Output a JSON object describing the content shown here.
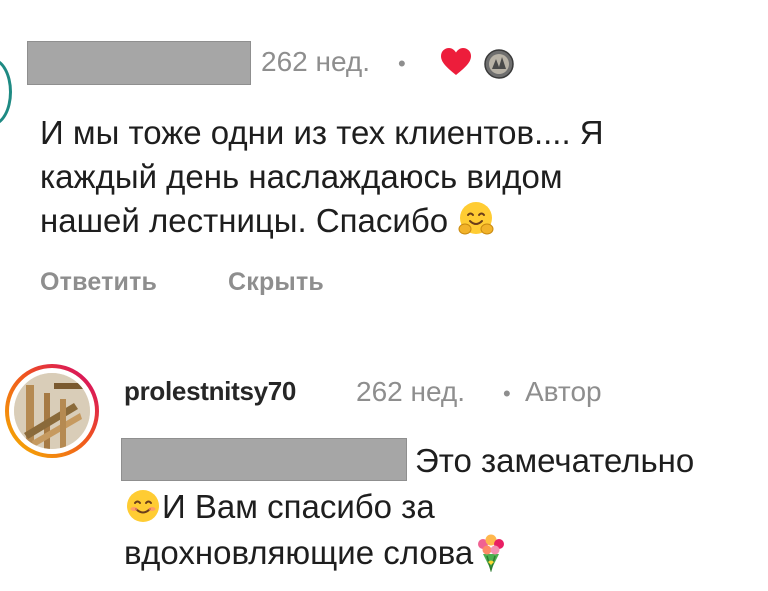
{
  "comment1": {
    "time": "262 нед.",
    "separator": "•",
    "text_line1": "И мы тоже одни из тех клиентов.... Я",
    "text_line2": "каждый день наслаждаюсь видом",
    "text_line3": "нашей лестницы. Спасибо",
    "actions": {
      "reply": "Ответить",
      "hide": "Скрыть"
    },
    "icons": [
      "heart-icon",
      "liker-avatar",
      "hugging-face-emoji"
    ],
    "colors": {
      "heart": "#ed1d3b"
    }
  },
  "comment2": {
    "username": "prolestnitsy70",
    "time": "262 нед.",
    "separator": "•",
    "author_badge": "Автор",
    "text_part1": "Это замечательно",
    "text_part2": "И Вам спасибо за",
    "text_part3": "вдохновляющие слова",
    "icons": [
      "smiling-face-emoji",
      "bouquet-emoji"
    ],
    "colors": {
      "story_ring_start": "#f5b400",
      "story_ring_end": "#d1006e"
    }
  }
}
